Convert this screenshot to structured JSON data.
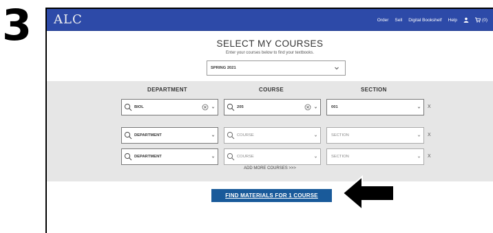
{
  "annotation": {
    "step_number": "3"
  },
  "header": {
    "logo": "ALC",
    "nav": [
      "Order",
      "Sell",
      "Digital Bookshelf",
      "Help"
    ],
    "cart_count": "(0)",
    "colors": {
      "bar": "#2d4aa8",
      "button": "#195a9a"
    }
  },
  "main": {
    "title": "SELECT MY COURSES",
    "subtitle": "Enter your courses below to find your textbooks.",
    "term": "SPRING 2021"
  },
  "courses": {
    "headers": {
      "department": "DEPARTMENT",
      "course": "COURSE",
      "section": "SECTION"
    },
    "rows": [
      {
        "department": "BIOL",
        "course": "205",
        "section": "001"
      },
      {
        "department": "DEPARTMENT",
        "course": "COURSE",
        "section": "SECTION"
      },
      {
        "department": "DEPARTMENT",
        "course": "COURSE",
        "section": "SECTION"
      }
    ],
    "remove_label": "X",
    "add_more": "ADD MORE COURSES >>>"
  },
  "find_button": "FIND MATERIALS FOR 1 COURSE"
}
